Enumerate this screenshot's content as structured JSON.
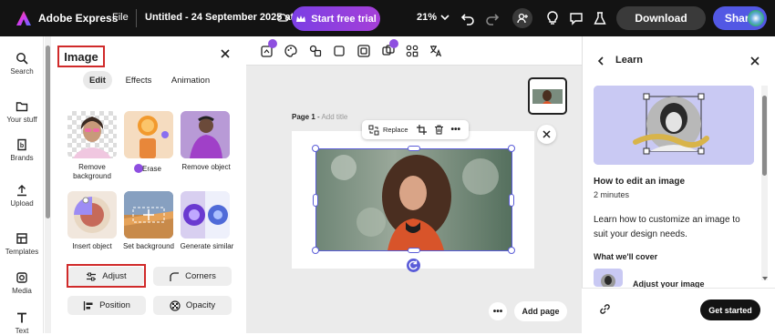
{
  "topbar": {
    "brand": "Adobe Express",
    "file_label": "File",
    "doc_title": "Untitled - 24 September 2025 at...",
    "trial_label": "Start free trial",
    "zoom": "21%",
    "download_label": "Download",
    "share_label": "Share"
  },
  "rail": {
    "items": [
      {
        "label": "Search",
        "icon": "search-icon"
      },
      {
        "label": "Your stuff",
        "icon": "folder-icon"
      },
      {
        "label": "Brands",
        "icon": "brand-icon"
      },
      {
        "label": "Upload",
        "icon": "upload-icon"
      },
      {
        "label": "Templates",
        "icon": "templates-icon"
      },
      {
        "label": "Media",
        "icon": "media-icon"
      },
      {
        "label": "Text",
        "icon": "text-icon"
      }
    ]
  },
  "panel": {
    "title": "Image",
    "tabs": [
      {
        "label": "Edit",
        "active": true
      },
      {
        "label": "Effects",
        "active": false
      },
      {
        "label": "Animation",
        "active": false
      }
    ],
    "tools": [
      {
        "label": "Remove background"
      },
      {
        "label": "Erase"
      },
      {
        "label": "Remove object"
      },
      {
        "label": "Insert object"
      },
      {
        "label": "Set background"
      },
      {
        "label": "Generate similar"
      }
    ],
    "buttons": {
      "adjust": "Adjust",
      "corners": "Corners",
      "position": "Position",
      "opacity": "Opacity"
    }
  },
  "canvas": {
    "page_label": "Page 1",
    "page_title_placeholder": "Add title",
    "context": {
      "replace_label": "Replace"
    },
    "add_page_label": "Add page"
  },
  "learn": {
    "title": "Learn",
    "card_title": "How to edit an image",
    "duration": "2 minutes",
    "description": "Learn how to customize an image to suit your design needs.",
    "cover_heading": "What we'll cover",
    "cover_item": "Adjust your image",
    "get_started_label": "Get started"
  },
  "colors": {
    "accent": "#5258e4",
    "highlight": "#d02a2a",
    "topbar": "#131313"
  }
}
